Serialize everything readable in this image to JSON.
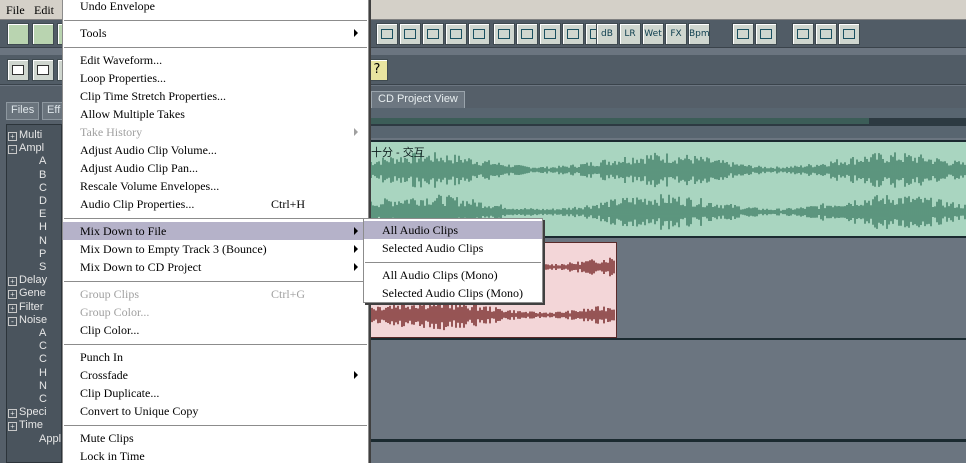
{
  "menubar": {
    "file": "File",
    "edit": "Edit"
  },
  "toolbar": {
    "row1_left": [
      "wave-icon",
      "tree-icon",
      "grid-icon"
    ],
    "row1_right": [
      "loop-icon",
      "mix-icon",
      "list-icon",
      "lock-icon",
      "bars-icon",
      "dots-icon",
      "knob-icon",
      "search-icon",
      "stairs-icon",
      "arrow-icon",
      "dB",
      "LR",
      "Wet",
      "FX",
      "Bpm",
      "split-icon",
      "clip-icon",
      "select-icon",
      "cursor-icon",
      "move-icon"
    ],
    "row2": [
      "window-icon",
      "envelope-icon",
      "doc-icon",
      "?"
    ]
  },
  "left_panel": {
    "tabs": [
      "Files",
      "Eff"
    ],
    "tree": [
      {
        "label": "Multi",
        "toggle": "+"
      },
      {
        "label": "Ampl",
        "toggle": "-"
      },
      {
        "label": "A"
      },
      {
        "label": "B"
      },
      {
        "label": "C"
      },
      {
        "label": "D"
      },
      {
        "label": "E"
      },
      {
        "label": "H"
      },
      {
        "label": "N"
      },
      {
        "label": "P"
      },
      {
        "label": "S"
      },
      {
        "label": "Delay",
        "toggle": "+"
      },
      {
        "label": "Gene",
        "toggle": "+"
      },
      {
        "label": "Filter",
        "toggle": "+"
      },
      {
        "label": "Noise",
        "toggle": "-"
      },
      {
        "label": "A"
      },
      {
        "label": "C"
      },
      {
        "label": "C"
      },
      {
        "label": "H"
      },
      {
        "label": "N"
      },
      {
        "label": "C"
      },
      {
        "label": "Speci",
        "toggle": "+"
      },
      {
        "label": "Time",
        "toggle": "+"
      },
      {
        "label": "Appl"
      }
    ]
  },
  "tracks": {
    "view_tab": "CD Project View",
    "track1_clip_label": "十分 - 交互"
  },
  "context_menu": {
    "items": [
      {
        "label": "Undo Envelope"
      },
      {
        "sep": true
      },
      {
        "label": "Tools",
        "submenu": true
      },
      {
        "sep": true
      },
      {
        "label": "Edit Waveform..."
      },
      {
        "label": "Loop Properties..."
      },
      {
        "label": "Clip Time Stretch Properties..."
      },
      {
        "label": "Allow Multiple Takes"
      },
      {
        "label": "Take History",
        "submenu": true,
        "disabled": true
      },
      {
        "label": "Adjust Audio Clip Volume..."
      },
      {
        "label": "Adjust Audio Clip Pan..."
      },
      {
        "label": "Rescale Volume Envelopes..."
      },
      {
        "label": "Audio Clip Properties...",
        "shortcut": "Ctrl+H"
      },
      {
        "sep": true
      },
      {
        "label": "Mix Down to File",
        "submenu": true,
        "highlighted": true
      },
      {
        "label": "Mix Down to Empty Track 3 (Bounce)",
        "submenu": true
      },
      {
        "label": "Mix Down to CD Project",
        "submenu": true
      },
      {
        "sep": true
      },
      {
        "label": "Group Clips",
        "shortcut": "Ctrl+G",
        "disabled": true
      },
      {
        "label": "Group Color...",
        "disabled": true
      },
      {
        "label": "Clip Color..."
      },
      {
        "sep": true
      },
      {
        "label": "Punch In"
      },
      {
        "label": "Crossfade",
        "submenu": true
      },
      {
        "label": "Clip Duplicate..."
      },
      {
        "label": "Convert to Unique Copy"
      },
      {
        "sep": true
      },
      {
        "label": "Mute Clips"
      },
      {
        "label": "Lock in Time"
      }
    ]
  },
  "submenu": {
    "items": [
      {
        "label": "All Audio Clips",
        "highlighted": true
      },
      {
        "label": "Selected Audio Clips"
      },
      {
        "sep": true
      },
      {
        "label": "All Audio Clips (Mono)"
      },
      {
        "label": "Selected Audio Clips (Mono)"
      }
    ]
  },
  "colors": {
    "menu_highlight": "#b5b2c9",
    "track1_bg": "#a9d5c0",
    "track1_wave": "#3c7a62",
    "clip2_bg": "#f3d6d8",
    "clip2_wave": "#6e1d1d"
  }
}
